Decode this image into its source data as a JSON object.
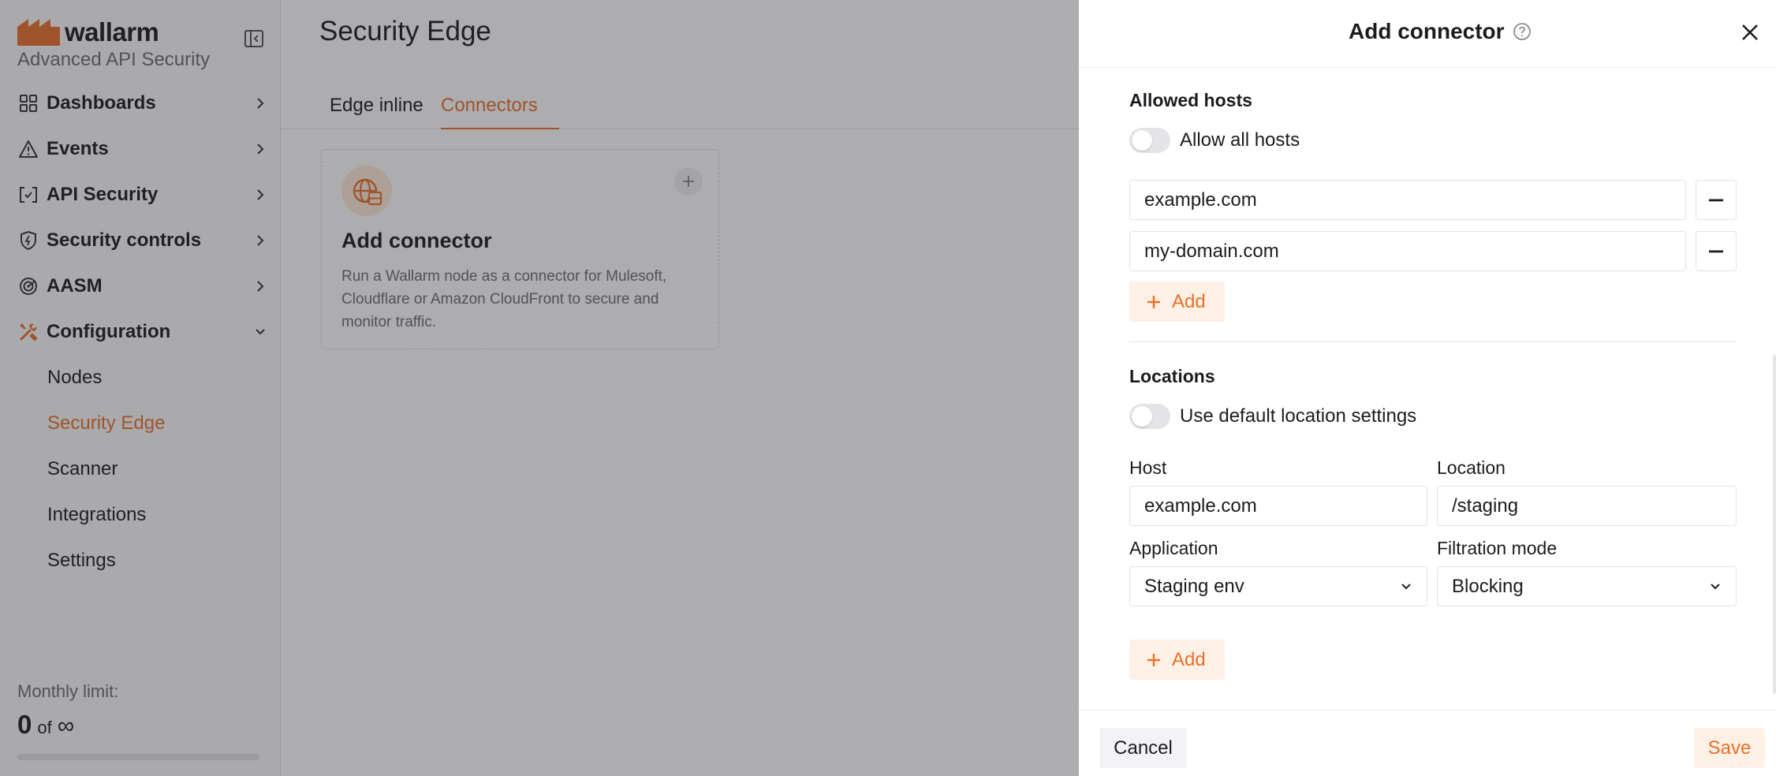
{
  "sidebar": {
    "logo_text": "wallarm",
    "product": "Advanced API Security",
    "nav": [
      {
        "label": "Dashboards",
        "icon": "dashboard-grid-icon"
      },
      {
        "label": "Events",
        "icon": "warning-triangle-icon"
      },
      {
        "label": "API Security",
        "icon": "api-brackets-icon"
      },
      {
        "label": "Security controls",
        "icon": "shield-icon"
      },
      {
        "label": "AASM",
        "icon": "radar-icon"
      },
      {
        "label": "Configuration",
        "icon": "tools-icon",
        "expanded": true
      }
    ],
    "sub_items": [
      "Nodes",
      "Security Edge",
      "Scanner",
      "Integrations",
      "Settings"
    ],
    "active_sub_item": "Security Edge",
    "monthly_limit": {
      "label": "Monthly limit:",
      "value": "0",
      "of": "of",
      "max": "∞",
      "used_fraction": 0
    }
  },
  "main": {
    "title": "Security Edge",
    "tabs": [
      {
        "label": "Edge inline",
        "active": false
      },
      {
        "label": "Connectors",
        "active": true
      }
    ],
    "card": {
      "title": "Add connector",
      "description": "Run a Wallarm node as a connector for Mulesoft, Cloudflare or Amazon CloudFront to secure and monitor traffic."
    }
  },
  "drawer": {
    "title": "Add connector",
    "allowed_hosts": {
      "title": "Allowed hosts",
      "toggle_label": "Allow all hosts",
      "toggle_on": false,
      "hosts": [
        "example.com",
        "my-domain.com"
      ],
      "add_label": "Add"
    },
    "locations": {
      "title": "Locations",
      "toggle_label": "Use default location settings",
      "toggle_on": false,
      "host_label": "Host",
      "location_label": "Location",
      "application_label": "Application",
      "filtration_label": "Filtration mode",
      "host_value": "example.com",
      "location_value": "/staging",
      "application_value": "Staging env",
      "filtration_value": "Blocking",
      "add_label": "Add"
    },
    "footer": {
      "cancel_label": "Cancel",
      "save_label": "Save"
    }
  },
  "colors": {
    "accent": "#e8702a",
    "accent_soft": "#fdf0e5",
    "text": "#1b1c1f",
    "muted": "#6b6d73"
  }
}
